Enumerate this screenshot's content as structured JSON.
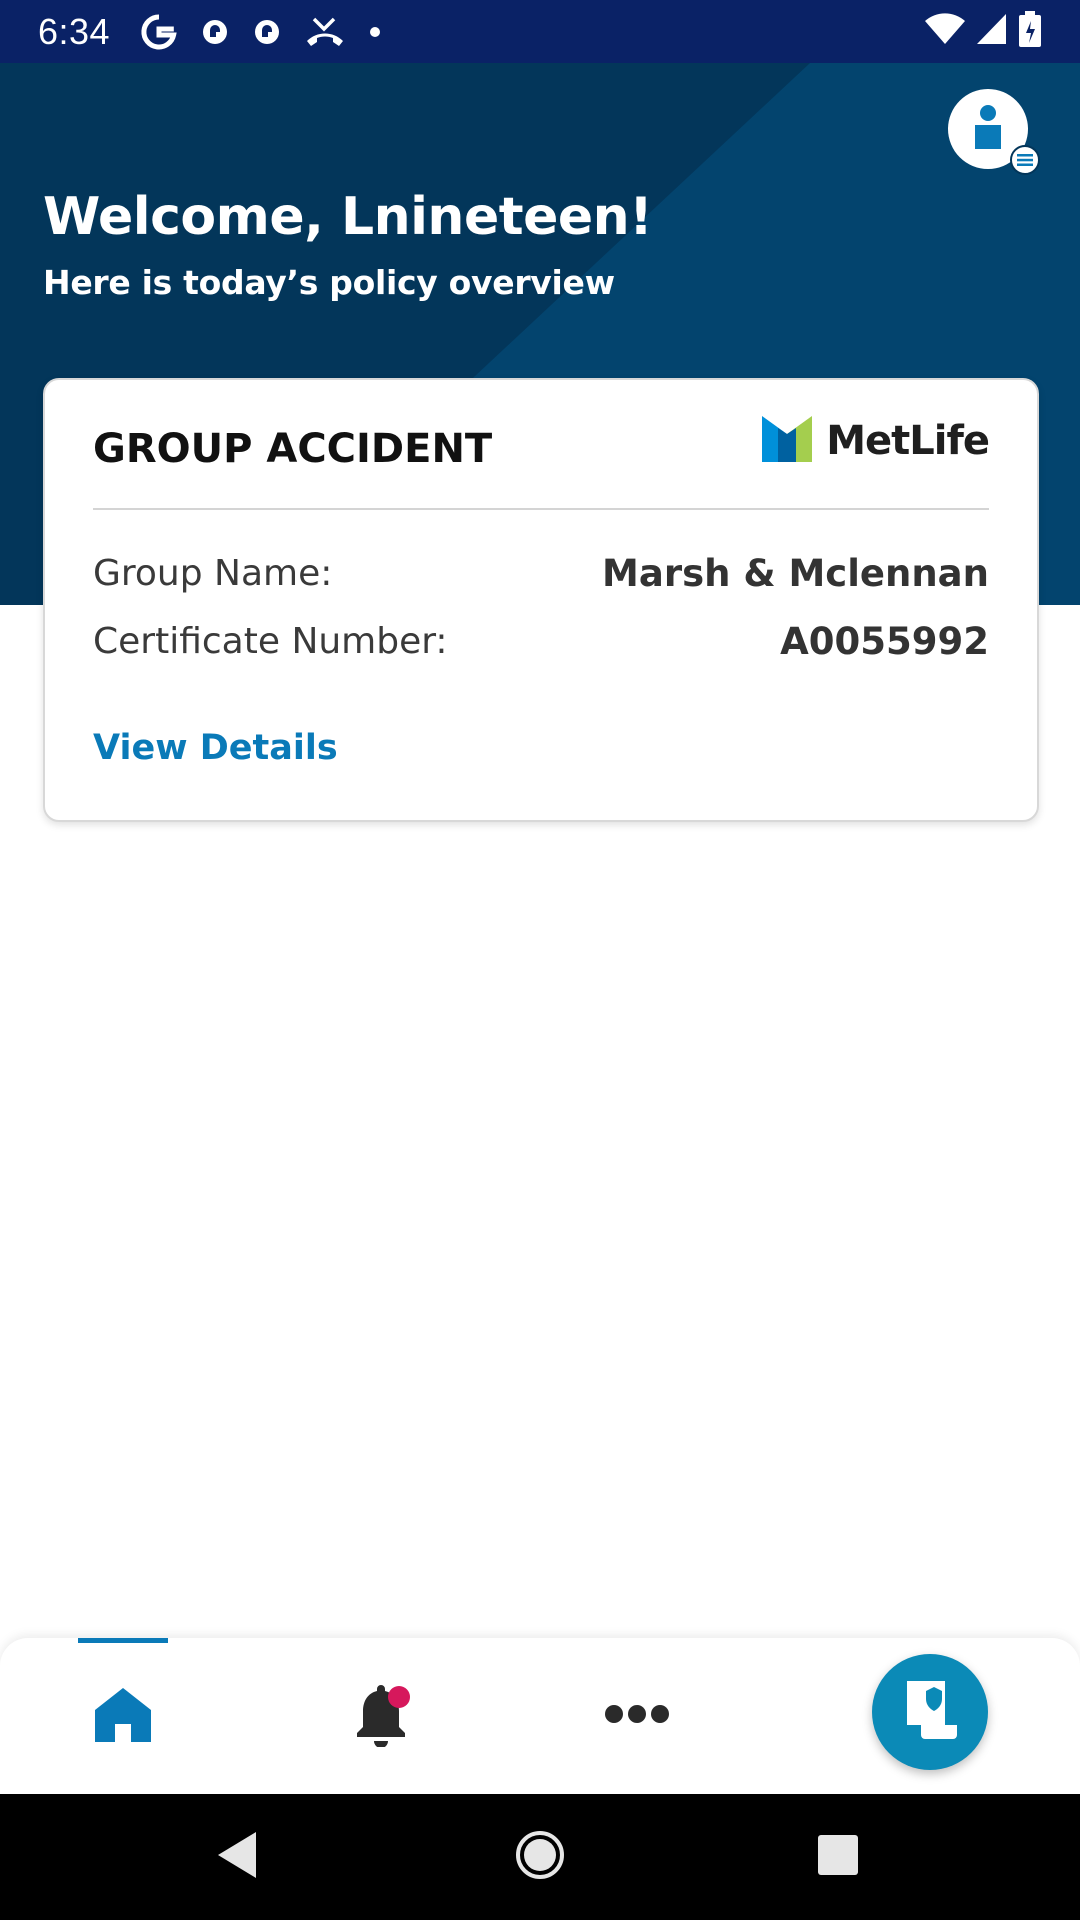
{
  "status_bar": {
    "time": "6:34",
    "icons": [
      "google-icon",
      "pocket-icon",
      "pocket-icon",
      "missed-call-icon",
      "dot-icon",
      "wifi-icon",
      "signal-icon",
      "battery-icon"
    ]
  },
  "header": {
    "welcome": "Welcome, Lnineteen!",
    "subtitle": "Here is today’s policy overview"
  },
  "policy_card": {
    "type": "GROUP ACCIDENT",
    "brand": "MetLife",
    "group_label": "Group Name:",
    "group_value": "Marsh & Mclennan",
    "cert_label": "Certificate Number:",
    "cert_value": "A0055992",
    "view_details": "View Details"
  },
  "bottom_nav": {
    "items": [
      "home-icon",
      "bell-icon",
      "more-icon",
      "claim-icon"
    ],
    "active": "home",
    "notification_dot": true
  },
  "colors": {
    "status_bar": "#0a2266",
    "header_bg": "#03365a",
    "accent": "#0a7ab8",
    "fab": "#0b8ab7",
    "badge": "#d6185c"
  }
}
